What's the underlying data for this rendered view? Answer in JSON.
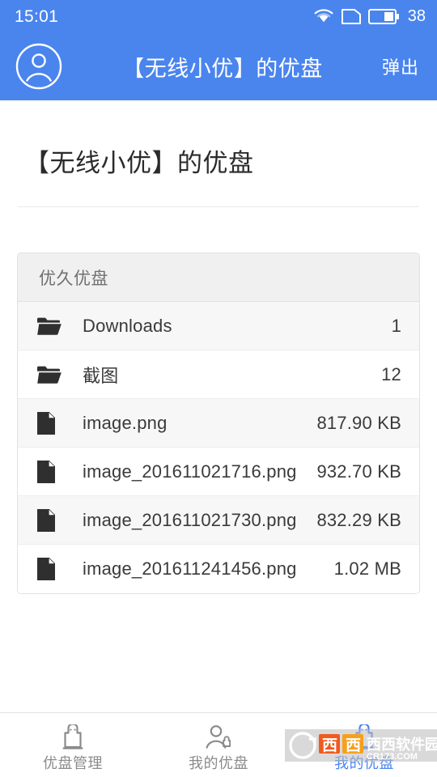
{
  "statusbar": {
    "time": "15:01",
    "battery_percent": "38",
    "icons": [
      "wifi-icon",
      "sim-card-icon",
      "battery-icon"
    ]
  },
  "appbar": {
    "avatar_icon": "user-avatar-icon",
    "title": "【无线小优】的优盘",
    "eject_label": "弹出"
  },
  "page": {
    "title": "【无线小优】的优盘"
  },
  "card": {
    "header": "优久优盘",
    "rows": [
      {
        "icon": "folder-icon",
        "name": "Downloads",
        "meta": "1"
      },
      {
        "icon": "folder-icon",
        "name": "截图",
        "meta": "12"
      },
      {
        "icon": "file-icon",
        "name": "image.png",
        "meta": "817.90 KB"
      },
      {
        "icon": "file-icon",
        "name": "image_201611021716.png",
        "meta": "932.70 KB"
      },
      {
        "icon": "file-icon",
        "name": "image_201611021730.png",
        "meta": "832.29 KB"
      },
      {
        "icon": "file-icon",
        "name": "image_201611241456.png",
        "meta": "1.02 MB"
      }
    ]
  },
  "bottomnav": {
    "tabs": [
      {
        "icon": "usb-drive-icon",
        "label": "优盘管理",
        "active": false
      },
      {
        "icon": "person-usb-icon",
        "label": "我的优盘",
        "active": false
      },
      {
        "icon": "usb-drive-blue-icon",
        "label": "我的优盘",
        "active": true
      }
    ]
  },
  "watermark": {
    "brand": "西西软件园",
    "url": "CR173.COM"
  },
  "colors": {
    "accent": "#4a85ee",
    "page_bg": "#ffffff",
    "card_header_bg": "#f0f0f0",
    "row_alt_bg": "#f7f7f7",
    "border": "#e2e2e2",
    "text_primary": "#3a3a3a",
    "text_muted": "#8b8b8b"
  }
}
